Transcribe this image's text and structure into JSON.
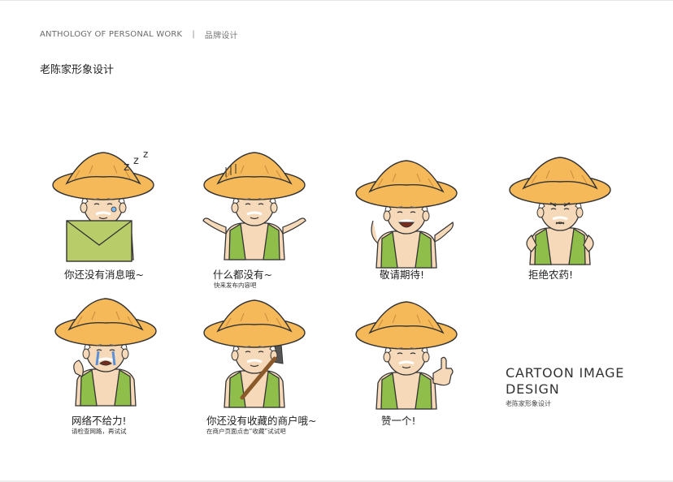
{
  "header": {
    "left": "ANTHOLOGY OF PERSONAL WORK",
    "separator": "|",
    "right": "品牌设计"
  },
  "page_title": "老陈家形象设计",
  "stickers": [
    {
      "label": "你还没有消息哦~",
      "sublabel": ""
    },
    {
      "label": "什么都没有~",
      "sublabel": "快来发布内容吧"
    },
    {
      "label": "敬请期待!",
      "sublabel": ""
    },
    {
      "label": "拒绝农药!",
      "sublabel": ""
    },
    {
      "label": "网络不给力!",
      "sublabel": "请检查网路，再试试"
    },
    {
      "label": "你还没有收藏的商户哦~",
      "sublabel": "在商户页面点击“收藏”试试吧"
    },
    {
      "label": "赞一个!",
      "sublabel": ""
    }
  ],
  "cartoon": {
    "line1": "CARTOON IMAGE",
    "line2": "DESIGN",
    "sub": "老陈家形象设计"
  },
  "colors": {
    "hat": "#f5b95a",
    "skin": "#f6d9b8",
    "vest": "#8fbf4a",
    "envelope": "#b9cc6a",
    "tear": "#5b8fd6"
  }
}
